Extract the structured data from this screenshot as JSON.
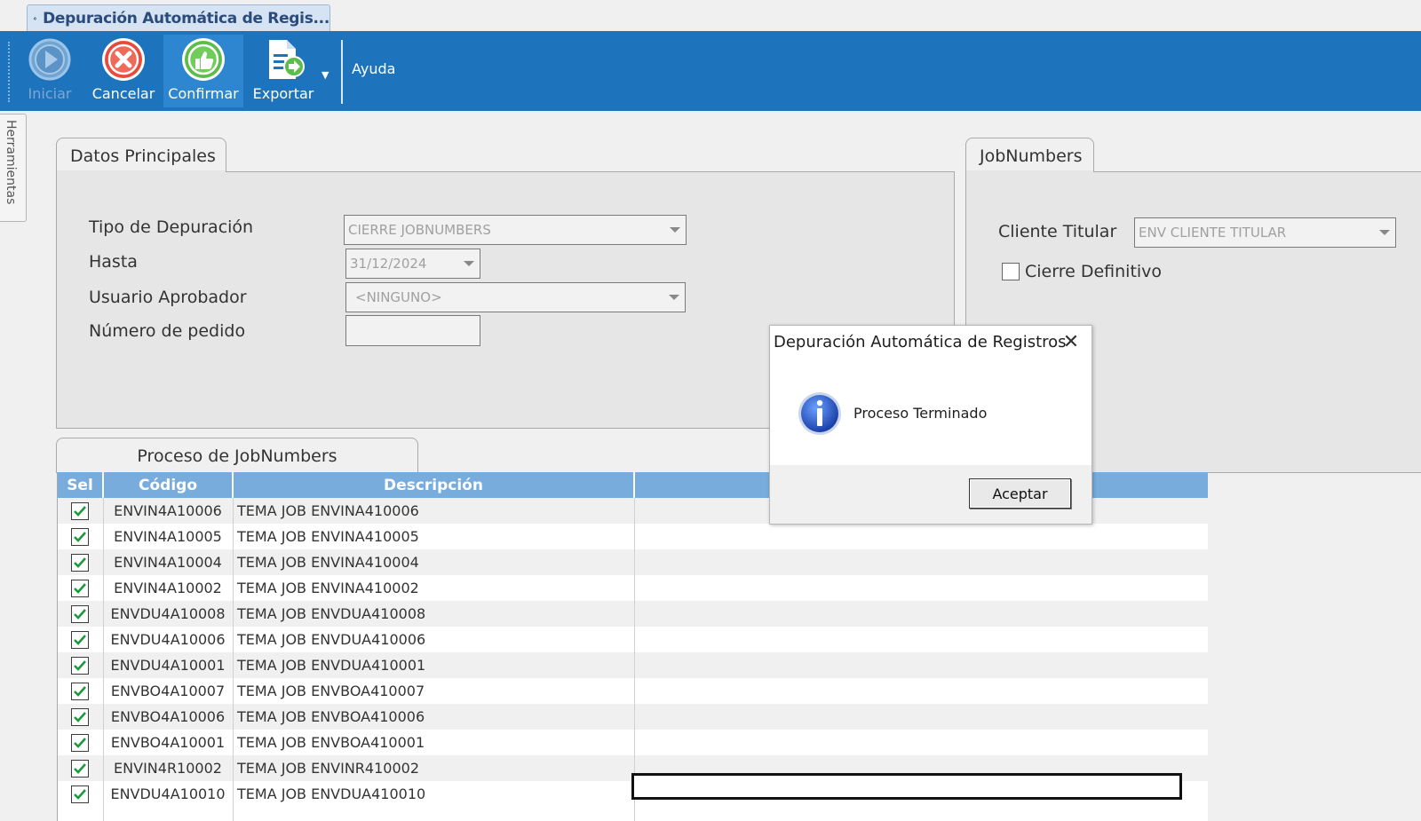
{
  "window": {
    "tab_title": "Depuración Automática de Regis..."
  },
  "ribbon": {
    "buttons": [
      {
        "label": "Iniciar",
        "icon": "play-icon",
        "enabled": false
      },
      {
        "label": "Cancelar",
        "icon": "cancel-icon",
        "enabled": true
      },
      {
        "label": "Confirmar",
        "icon": "thumbs-up-icon",
        "enabled": true,
        "active": true
      },
      {
        "label": "Exportar",
        "icon": "export-document-icon",
        "enabled": true
      }
    ],
    "help_label": "Ayuda"
  },
  "side_panel": {
    "label": "Herramientas"
  },
  "datos_principales": {
    "title": "Datos Principales",
    "tipo_label": "Tipo de Depuración",
    "tipo_value": "CIERRE JOBNUMBERS",
    "hasta_label": "Hasta",
    "hasta_value": "31/12/2024",
    "usuario_label": "Usuario Aprobador",
    "usuario_value": "<NINGUNO>",
    "pedido_label": "Número de pedido",
    "pedido_value": ""
  },
  "jobnumbers": {
    "title": "JobNumbers",
    "cliente_label": "Cliente Titular",
    "cliente_value": "ENV CLIENTE TITULAR",
    "cierre_label": "Cierre Definitivo",
    "cierre_checked": false
  },
  "proceso": {
    "title": "Proceso de JobNumbers",
    "columns": {
      "sel": "Sel",
      "codigo": "Código",
      "descripcion": "Descripción",
      "extra": ""
    },
    "rows": [
      {
        "checked": true,
        "codigo": "ENVIN4A10006",
        "descripcion": "TEMA JOB ENVINA410006"
      },
      {
        "checked": true,
        "codigo": "ENVIN4A10005",
        "descripcion": "TEMA JOB ENVINA410005"
      },
      {
        "checked": true,
        "codigo": "ENVIN4A10004",
        "descripcion": "TEMA JOB ENVINA410004"
      },
      {
        "checked": true,
        "codigo": "ENVIN4A10002",
        "descripcion": "TEMA JOB ENVINA410002"
      },
      {
        "checked": true,
        "codigo": "ENVDU4A10008",
        "descripcion": "TEMA JOB ENVDUA410008"
      },
      {
        "checked": true,
        "codigo": "ENVDU4A10006",
        "descripcion": "TEMA JOB ENVDUA410006"
      },
      {
        "checked": true,
        "codigo": "ENVDU4A10001",
        "descripcion": "TEMA JOB ENVDUA410001"
      },
      {
        "checked": true,
        "codigo": "ENVBO4A10007",
        "descripcion": "TEMA JOB ENVBOA410007"
      },
      {
        "checked": true,
        "codigo": "ENVBO4A10006",
        "descripcion": "TEMA JOB ENVBOA410006"
      },
      {
        "checked": true,
        "codigo": "ENVBO4A10001",
        "descripcion": "TEMA JOB ENVBOA410001"
      },
      {
        "checked": true,
        "codigo": "ENVIN4R10002",
        "descripcion": "TEMA JOB ENVINR410002"
      },
      {
        "checked": true,
        "codigo": "ENVDU4A10010",
        "descripcion": "TEMA JOB ENVDUA410010"
      }
    ]
  },
  "dialog": {
    "title": "Depuración Automática de Registros",
    "message": "Proceso Terminado",
    "ok_label": "Aceptar",
    "icon": "info-icon"
  },
  "colors": {
    "ribbon": "#1d74bd",
    "grid_header": "#78acdd",
    "check": "#1a9a3a"
  }
}
